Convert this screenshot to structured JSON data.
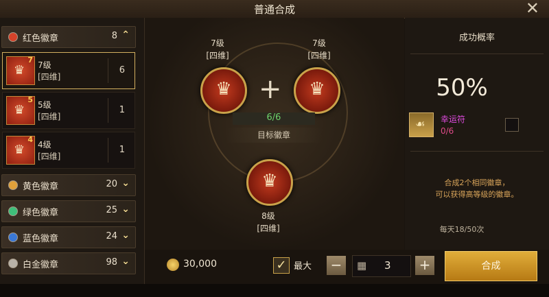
{
  "title": "普通合成",
  "categories": [
    {
      "label": "红色徽章",
      "count": "8",
      "color": "#d6432a",
      "expanded": true
    },
    {
      "label": "黄色徽章",
      "count": "20",
      "color": "#e0a13a"
    },
    {
      "label": "绿色徽章",
      "count": "25",
      "color": "#3fbf7a"
    },
    {
      "label": "蓝色徽章",
      "count": "24",
      "color": "#3a78d6"
    },
    {
      "label": "白金徽章",
      "count": "98",
      "color": "#b8b2a8"
    }
  ],
  "red_items": [
    {
      "level_num": "7",
      "level": "7级",
      "type": "[四维]",
      "count": "6"
    },
    {
      "level_num": "5",
      "level": "5级",
      "type": "[四维]",
      "count": "1"
    },
    {
      "level_num": "4",
      "level": "4级",
      "type": "[四维]",
      "count": "1"
    }
  ],
  "synthesis": {
    "input1_level": "7级",
    "input1_type": "[四维]",
    "input2_level": "7级",
    "input2_type": "[四维]",
    "progress": "6/6",
    "target_label": "目标徽章",
    "result_level": "8级",
    "result_type": "[四维]"
  },
  "right_panel": {
    "header": "成功概率",
    "rate": "50%",
    "charm_name": "幸运符",
    "charm_count": "0/6",
    "desc_line1": "合成2个相同徽章，",
    "desc_line2": "可以获得高等级的徽章。",
    "daily": "每天18/50次"
  },
  "bottom": {
    "gold": "30,000",
    "max_label": "最大",
    "minus": "−",
    "quantity": "3",
    "plus": "+",
    "synth_button": "合成"
  }
}
